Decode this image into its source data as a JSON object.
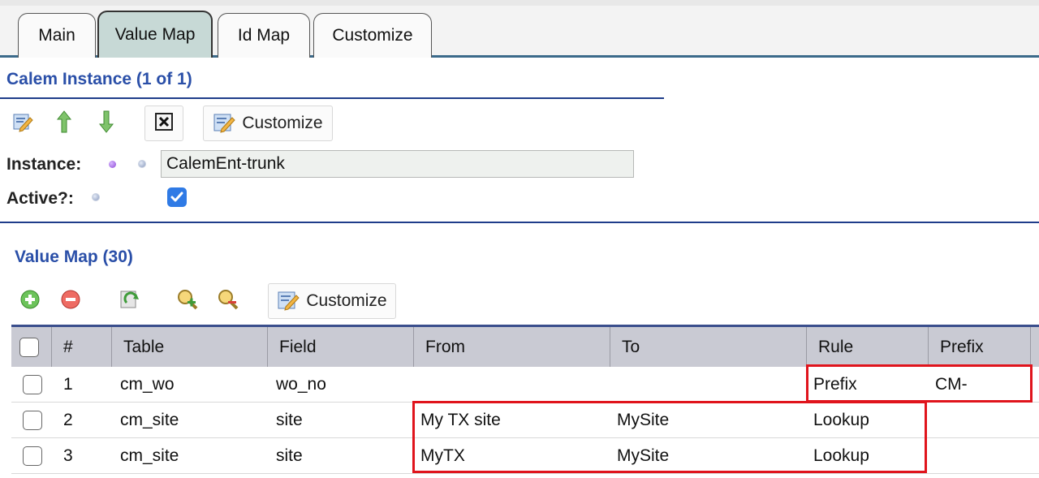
{
  "tabs": [
    {
      "label": "Main"
    },
    {
      "label": "Value Map"
    },
    {
      "label": "Id Map"
    },
    {
      "label": "Customize"
    }
  ],
  "instance_section": {
    "title": "Calem Instance (1 of 1)",
    "toolbar": {
      "customize_label": "Customize"
    },
    "fields": {
      "instance_label": "Instance:",
      "instance_value": "CalemEnt-trunk",
      "active_label": "Active?:",
      "active_checked": true
    }
  },
  "value_map_section": {
    "title": "Value Map (30)",
    "toolbar": {
      "customize_label": "Customize"
    },
    "columns": [
      "#",
      "Table",
      "Field",
      "From",
      "To",
      "Rule",
      "Prefix"
    ],
    "rows": [
      {
        "num": "1",
        "table": "cm_wo",
        "field": "wo_no",
        "from": "",
        "to": "",
        "rule": "Prefix",
        "prefix": "CM-"
      },
      {
        "num": "2",
        "table": "cm_site",
        "field": "site",
        "from": "My TX site",
        "to": "MySite",
        "rule": "Lookup",
        "prefix": ""
      },
      {
        "num": "3",
        "table": "cm_site",
        "field": "site",
        "from": "MyTX",
        "to": "MySite",
        "rule": "Lookup",
        "prefix": ""
      }
    ]
  },
  "colors": {
    "accent_blue": "#2a4fa8",
    "active_tab": "#c7d9d6",
    "highlight_red": "#e0141c",
    "header_gray": "#c9cad3"
  }
}
